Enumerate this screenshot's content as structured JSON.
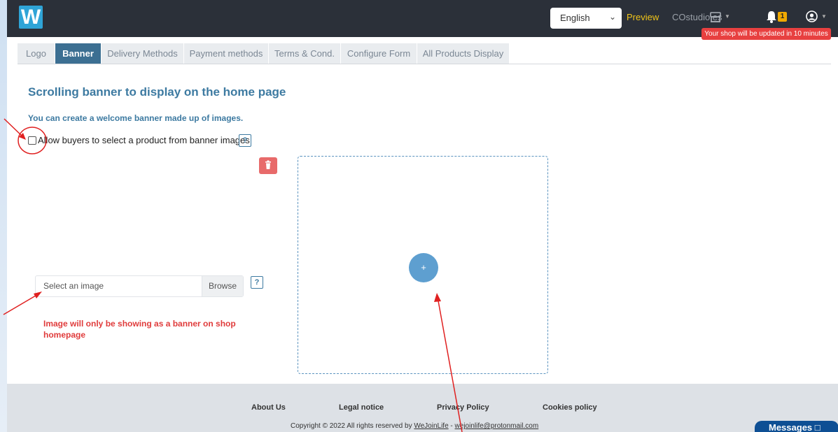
{
  "header": {
    "logo_letter": "W",
    "language": "English",
    "preview": "Preview",
    "shop_name": "COstudio.es",
    "notification_count": "1",
    "update_notice": "Your shop will be updated in 10 minutes"
  },
  "tabs": [
    {
      "label": "Logo"
    },
    {
      "label": "Banner"
    },
    {
      "label": "Delivery Methods"
    },
    {
      "label": "Payment methods"
    },
    {
      "label": "Terms & Cond."
    },
    {
      "label": "Configure Form"
    },
    {
      "label": "All Products Display"
    }
  ],
  "main": {
    "title": "Scrolling banner to display on the home page",
    "subtitle": "You can create a welcome banner made up of images.",
    "checkbox_label": "Allow buyers to select a product from banner images",
    "help_glyph": "?",
    "file_placeholder": "Select an image",
    "browse_label": "Browse",
    "warning": "Image will only be showing as a banner on shop homepage",
    "add_glyph": "+"
  },
  "footer": {
    "links": [
      "About Us",
      "Legal notice",
      "Privacy Policy",
      "Cookies policy"
    ],
    "copyright_prefix": "Copyright © 2022 All rights reserved by ",
    "company": "WeJoinLife",
    "separator": " - ",
    "email": "wejoinlife@protonmail.com",
    "messages": "Messages"
  },
  "colors": {
    "topbar": "#2b3039",
    "accent": "#3c6f92",
    "title": "#3d7aa1",
    "warning": "#e03b3b",
    "annotation": "#e02020"
  }
}
